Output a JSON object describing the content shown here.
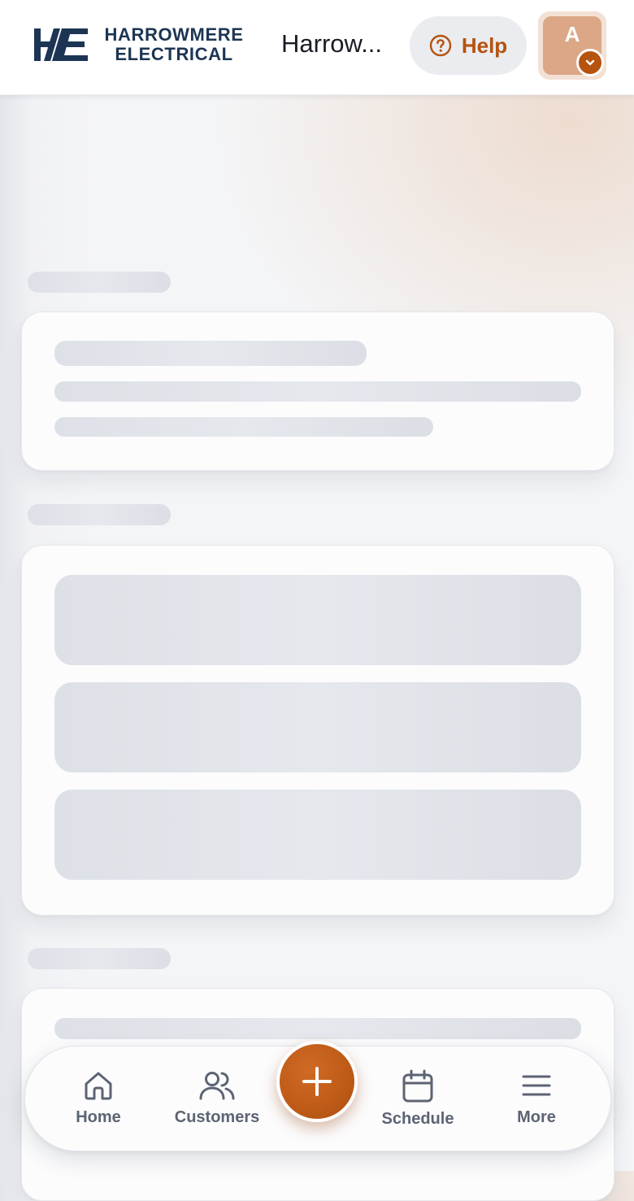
{
  "header": {
    "logo": {
      "mark_text": "HE",
      "line1": "HARROWMERE",
      "line2": "ELECTRICAL"
    },
    "company_name": "Harrow...",
    "help_label": "Help",
    "help_icon": "question-circle-icon",
    "avatar_initial": "A",
    "avatar_badge_icon": "chevron-down-icon"
  },
  "bottom_nav": {
    "items": [
      {
        "label": "Home",
        "icon": "home-icon"
      },
      {
        "label": "Customers",
        "icon": "users-icon"
      },
      {
        "label": "Schedule",
        "icon": "calendar-icon"
      },
      {
        "label": "More",
        "icon": "menu-icon"
      }
    ],
    "fab_icon": "plus-icon"
  },
  "colors": {
    "accent": "#b5530f",
    "brand_navy": "#1d3554",
    "skeleton": "#dde1e7",
    "avatar_bg": "#dba786",
    "nav_text": "#5c6473"
  }
}
